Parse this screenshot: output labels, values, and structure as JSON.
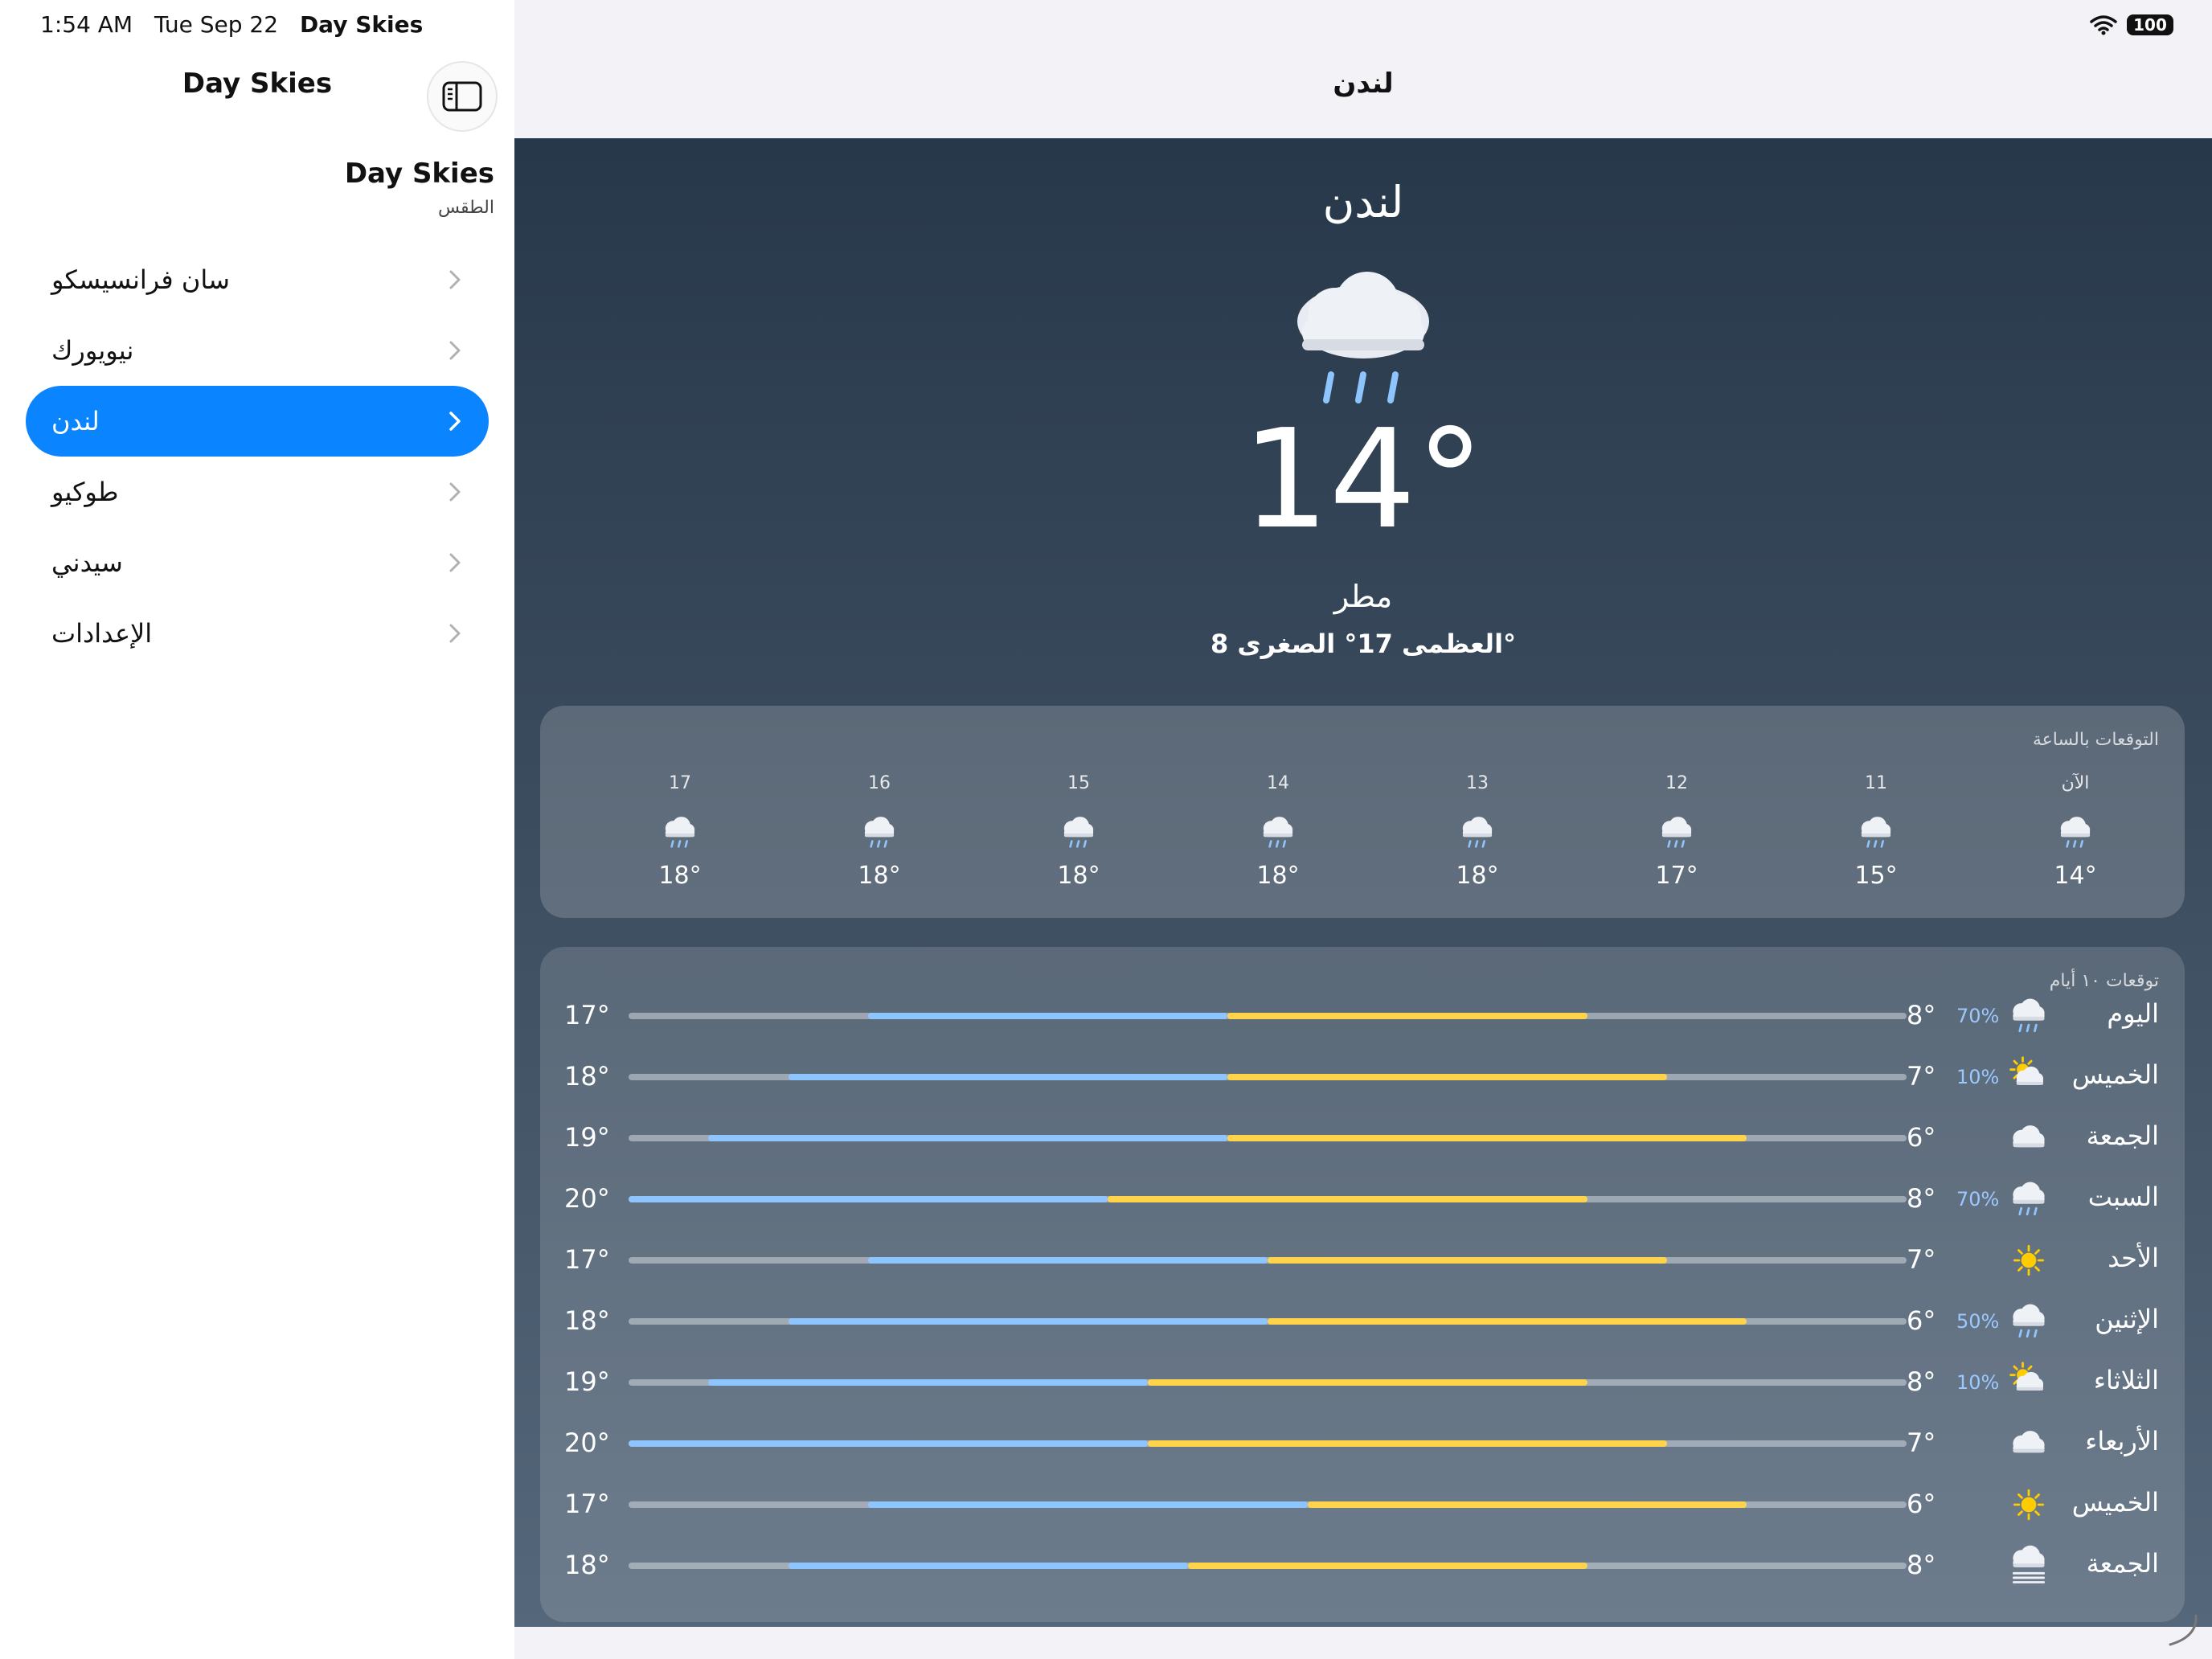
{
  "status_bar": {
    "time": "1:54 AM",
    "date": "Tue Sep 22",
    "app": "Day Skies",
    "battery": "100"
  },
  "sidebar": {
    "title": "Day Skies",
    "app_name": "Day Skies",
    "app_subtitle": "الطقس",
    "items": [
      {
        "label": "سان فرانسيسكو",
        "active": false
      },
      {
        "label": "نيويورك",
        "active": false
      },
      {
        "label": "لندن",
        "active": true
      },
      {
        "label": "طوكيو",
        "active": false
      },
      {
        "label": "سيدني",
        "active": false
      },
      {
        "label": "الإعدادات",
        "active": false
      }
    ]
  },
  "nav": {
    "title": "لندن"
  },
  "current": {
    "city": "لندن",
    "icon": "cloud-rain-icon",
    "temperature": "14°",
    "condition": "مطر",
    "hilo": "العظمى 17° الصغرى 8°"
  },
  "hourly": {
    "title": "التوقعات بالساعة",
    "hours": [
      {
        "label": "الآن",
        "icon": "cloud-rain-icon",
        "temp": "14°"
      },
      {
        "label": "11",
        "icon": "cloud-rain-icon",
        "temp": "15°"
      },
      {
        "label": "12",
        "icon": "cloud-rain-icon",
        "temp": "17°"
      },
      {
        "label": "13",
        "icon": "cloud-rain-icon",
        "temp": "18°"
      },
      {
        "label": "14",
        "icon": "cloud-rain-icon",
        "temp": "18°"
      },
      {
        "label": "15",
        "icon": "cloud-rain-icon",
        "temp": "18°"
      },
      {
        "label": "16",
        "icon": "cloud-rain-icon",
        "temp": "18°"
      },
      {
        "label": "17",
        "icon": "cloud-rain-icon",
        "temp": "18°"
      }
    ]
  },
  "daily": {
    "title": "توقعات ١٠ أيام",
    "range_min": 4,
    "range_max": 20,
    "days": [
      {
        "name": "اليوم",
        "icon": "cloud-rain-icon",
        "pct": "70%",
        "low": "8°",
        "high": "17°",
        "low_val": 8,
        "high_val": 17
      },
      {
        "name": "الخميس",
        "icon": "sun-cloud-icon",
        "pct": "10%",
        "low": "7°",
        "high": "18°",
        "low_val": 7,
        "high_val": 18
      },
      {
        "name": "الجمعة",
        "icon": "cloud-icon",
        "pct": "",
        "low": "6°",
        "high": "19°",
        "low_val": 6,
        "high_val": 19
      },
      {
        "name": "السبت",
        "icon": "cloud-rain-icon",
        "pct": "70%",
        "low": "8°",
        "high": "20°",
        "low_val": 8,
        "high_val": 20
      },
      {
        "name": "الأحد",
        "icon": "sun-icon",
        "pct": "",
        "low": "7°",
        "high": "17°",
        "low_val": 7,
        "high_val": 17
      },
      {
        "name": "الإثنين",
        "icon": "cloud-rain-icon",
        "pct": "50%",
        "low": "6°",
        "high": "18°",
        "low_val": 6,
        "high_val": 18
      },
      {
        "name": "الثلاثاء",
        "icon": "sun-cloud-icon",
        "pct": "10%",
        "low": "8°",
        "high": "19°",
        "low_val": 8,
        "high_val": 19
      },
      {
        "name": "الأربعاء",
        "icon": "cloud-icon",
        "pct": "",
        "low": "7°",
        "high": "20°",
        "low_val": 7,
        "high_val": 20
      },
      {
        "name": "الخميس",
        "icon": "sun-icon",
        "pct": "",
        "low": "6°",
        "high": "17°",
        "low_val": 6,
        "high_val": 17
      },
      {
        "name": "الجمعة",
        "icon": "fog-icon",
        "pct": "",
        "low": "8°",
        "high": "18°",
        "low_val": 8,
        "high_val": 18
      }
    ]
  },
  "colors": {
    "accent": "#0a84ff",
    "cool_bar": "#8ec5ff",
    "warm_bar": "#ffd34a",
    "precip": "#9cc8ff"
  }
}
